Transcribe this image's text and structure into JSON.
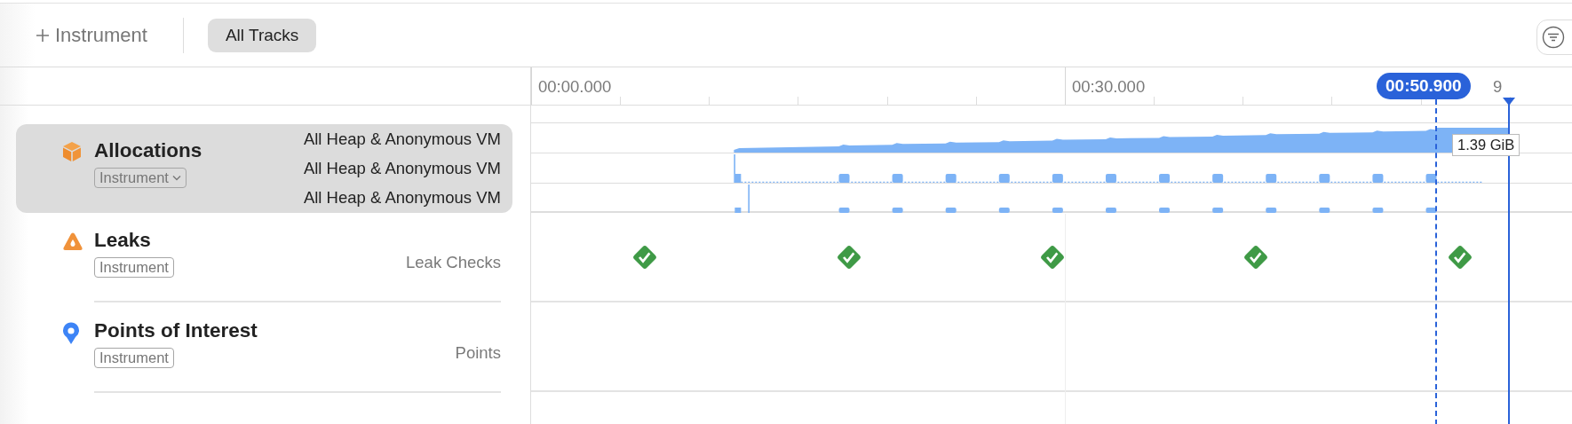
{
  "toolbar": {
    "add_button": {
      "label": "Instrument"
    },
    "filter_tabs": [
      {
        "label": "All Tracks",
        "selected": true
      }
    ]
  },
  "ruler": {
    "labels": [
      "00:00.000",
      "00:30.000"
    ],
    "clipped_label": "9",
    "inspection_time": "00:50.900"
  },
  "tracks": [
    {
      "kind": "allocations",
      "name": "Allocations",
      "badge": "Instrument",
      "badge_menu": true,
      "selected": true,
      "lanes": [
        "All Heap & Anonymous VM",
        "All Heap & Anonymous VM",
        "All Heap & Anonymous VM"
      ],
      "value_label": "1.39 GiB"
    },
    {
      "kind": "leaks",
      "name": "Leaks",
      "badge": "Instrument",
      "badge_menu": false,
      "selected": false,
      "lanes": [
        "Leak Checks"
      ],
      "checks": [
        {
          "passed": true
        },
        {
          "passed": true
        },
        {
          "passed": true
        },
        {
          "passed": true
        },
        {
          "passed": true
        }
      ]
    },
    {
      "kind": "points",
      "name": "Points of Interest",
      "badge": "Instrument",
      "badge_menu": false,
      "selected": false,
      "lanes": [
        "Points"
      ]
    }
  ]
}
